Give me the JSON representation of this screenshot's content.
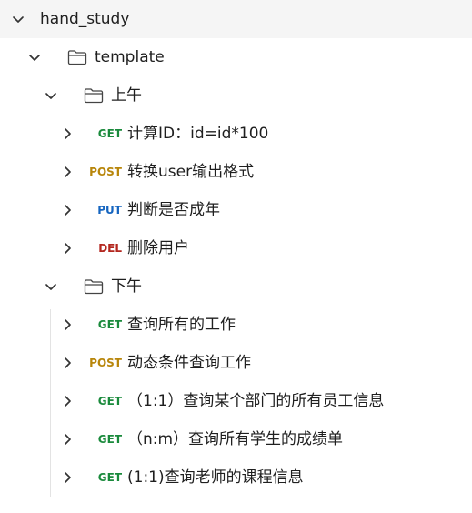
{
  "collection": {
    "name": "hand_study"
  },
  "folder": {
    "name": "template"
  },
  "groups": [
    {
      "name": "上午",
      "requests": [
        {
          "method": "GET",
          "method_color": "#1a8a3c",
          "name": "计算ID：id=id*100"
        },
        {
          "method": "POST",
          "method_color": "#b8860b",
          "name": "转换user输出格式"
        },
        {
          "method": "PUT",
          "method_color": "#1565c0",
          "name": "判断是否成年"
        },
        {
          "method": "DEL",
          "method_color": "#b3261e",
          "name": "删除用户"
        }
      ]
    },
    {
      "name": "下午",
      "requests": [
        {
          "method": "GET",
          "method_color": "#1a8a3c",
          "name": "查询所有的工作"
        },
        {
          "method": "POST",
          "method_color": "#b8860b",
          "name": "动态条件查询工作"
        },
        {
          "method": "GET",
          "method_color": "#1a8a3c",
          "name": "（1:1）查询某个部门的所有员工信息"
        },
        {
          "method": "GET",
          "method_color": "#1a8a3c",
          "name": "（n:m）查询所有学生的成绩单"
        },
        {
          "method": "GET",
          "method_color": "#1a8a3c",
          "name": "(1:1)查询老师的课程信息"
        }
      ]
    }
  ],
  "icons": {
    "expanded": "chevron-down-icon",
    "collapsed": "chevron-right-icon",
    "folder": "folder-icon"
  }
}
